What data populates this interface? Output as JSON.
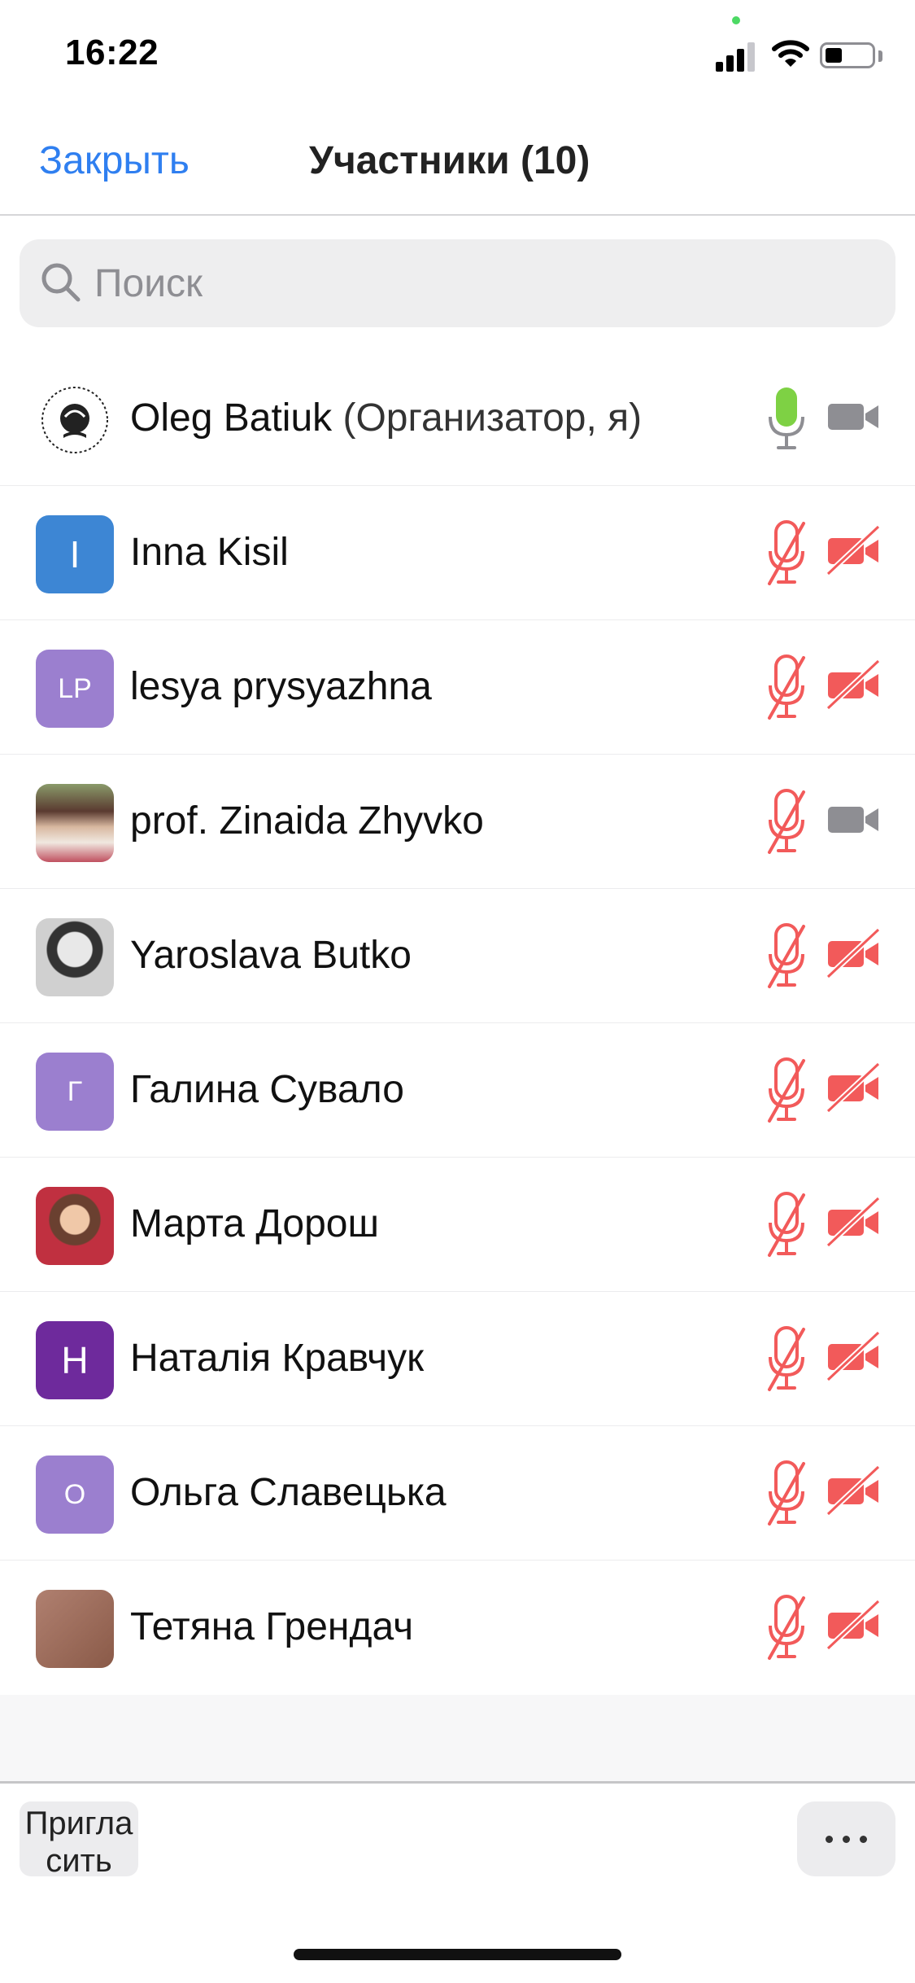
{
  "status": {
    "time": "16:22"
  },
  "nav": {
    "close_label": "Закрыть",
    "title": "Участники (10)"
  },
  "search": {
    "placeholder": "Поиск",
    "value": ""
  },
  "colors": {
    "accent": "#2f7ff0",
    "muted_red": "#f25a5a",
    "active_green": "#7ed144",
    "camera_gray": "#8e8e93"
  },
  "participants": [
    {
      "name": "Oleg Batiuk",
      "role": "(Организатор, я)",
      "avatar": "logo",
      "mic": "on",
      "camera": "off-gray"
    },
    {
      "name": "Inna Kisil",
      "initials": "I",
      "avatar_color": "#3d86d4",
      "mic": "muted",
      "camera": "off"
    },
    {
      "name": "lesya prysyazhna",
      "initials": "LP",
      "avatar_color": "#9b7fcf",
      "mic": "muted",
      "camera": "off"
    },
    {
      "name": "prof. Zinaida Zhyvko",
      "avatar": "photo",
      "mic": "muted",
      "camera": "off-gray"
    },
    {
      "name": "Yaroslava Butko",
      "avatar": "photo",
      "mic": "muted",
      "camera": "off"
    },
    {
      "name": "Галина Сувало",
      "initials": "Г",
      "avatar_color": "#9b7fcf",
      "mic": "muted",
      "camera": "off"
    },
    {
      "name": "Марта Дорош",
      "avatar": "photo",
      "mic": "muted",
      "camera": "off"
    },
    {
      "name": "Наталія Кравчук",
      "initials": "Н",
      "avatar_color": "#6e2a9c",
      "mic": "muted",
      "camera": "off"
    },
    {
      "name": "Ольга Славецька",
      "initials": "О",
      "avatar_color": "#9b7fcf",
      "mic": "muted",
      "camera": "off"
    },
    {
      "name": "Тетяна Грендач",
      "avatar": "photo",
      "mic": "muted",
      "camera": "off"
    }
  ],
  "bottom": {
    "invite_label": "Пригласить",
    "more_icon": "ellipsis-icon"
  }
}
